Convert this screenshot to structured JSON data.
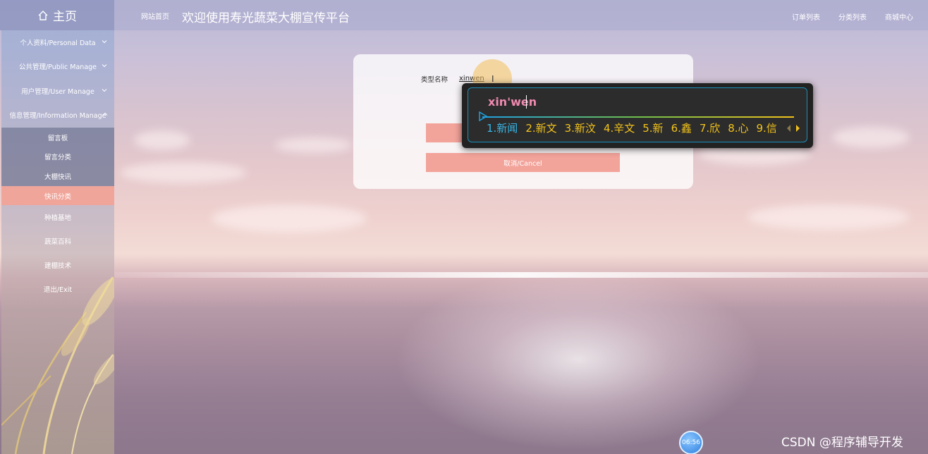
{
  "header": {
    "home_label": "主页",
    "site_link": "网站首页",
    "site_title": "欢迎使用寿光蔬菜大棚宣传平台",
    "nav": [
      "订单列表",
      "分类列表",
      "商城中心"
    ]
  },
  "sidebar": {
    "items": [
      {
        "label": "个人资料/Personal Data"
      },
      {
        "label": "公共管理/Public Manage"
      },
      {
        "label": "用户管理/User Manage"
      },
      {
        "label": "信息管理/Information Manage"
      }
    ],
    "submenu": [
      "留言板",
      "留言分类",
      "大棚快讯",
      "快讯分类"
    ],
    "active_sub": "快讯分类",
    "more_items": [
      "种植基地",
      "蔬菜百科",
      "建棚技术",
      "退出/Exit"
    ]
  },
  "form": {
    "type_name_label": "类型名称",
    "type_name_value": "xinwen",
    "submit_label": "",
    "cancel_label": "取消/Cancel"
  },
  "ime": {
    "pinyin": "xin'wen",
    "candidates": [
      "1.新闻",
      "2.新文",
      "3.新汶",
      "4.辛文",
      "5.新",
      "6.鑫",
      "7.欣",
      "8.心",
      "9.信"
    ]
  },
  "clock": "06:56",
  "watermark": "CSDN @程序辅导开发",
  "colors": {
    "accent": "#f2a39a",
    "ime_bg": "#222222",
    "ime_candidate": "#f2c21b",
    "ime_pinyin": "#f08ab0"
  }
}
